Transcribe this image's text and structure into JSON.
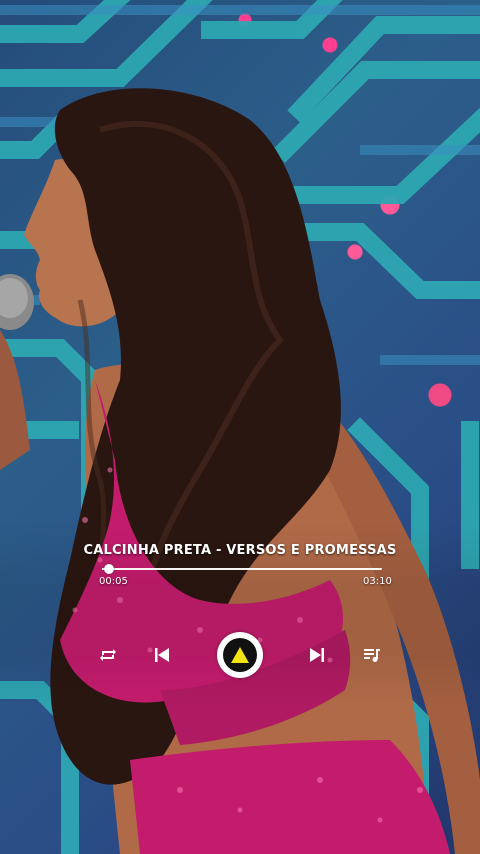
{
  "player": {
    "song_title": "CALCINHA PRETA - VERSOS E PROMESSAS",
    "current_time": "00:05",
    "total_time": "03:10",
    "progress": 0.026,
    "controls": {
      "repeat_icon": "repeat-icon",
      "previous_icon": "skip-previous-icon",
      "play_icon": "play-triangle-icon",
      "next_icon": "skip-next-icon",
      "queue_icon": "playlist-icon"
    }
  },
  "colors": {
    "accent": "#f4e313",
    "text": "#ffffff",
    "background": "#2c5e8a",
    "dress": "#c41c6d"
  }
}
